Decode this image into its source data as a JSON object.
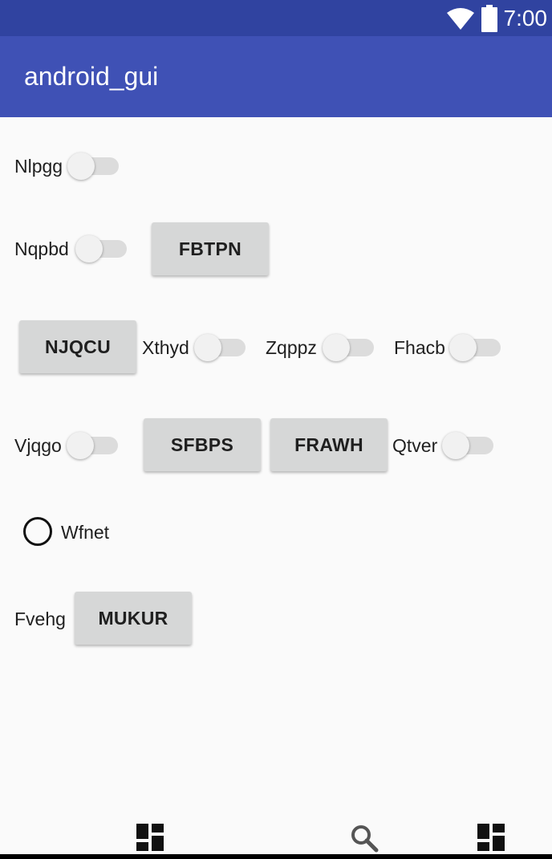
{
  "status_bar": {
    "time": "7:00",
    "wifi_icon": "wifi-icon",
    "battery_icon": "battery-icon"
  },
  "app_bar": {
    "title": "android_gui"
  },
  "rows": {
    "row1": {
      "label": "Nlpgg"
    },
    "row2": {
      "label": "Nqpbd",
      "button": "FBTPN"
    },
    "row3": {
      "button": "NJQCU",
      "label1": "Xthyd",
      "label2": "Zqppz",
      "label3": "Fhacb"
    },
    "row4": {
      "label1": "Vjqgo",
      "button1": "SFBPS",
      "button2": "FRAWH",
      "label2": "Qtver"
    },
    "row5": {
      "radio_label": "Wfnet"
    },
    "row6": {
      "label": "Fvehg",
      "button": "MUKUR"
    }
  },
  "switches": {
    "all_off": true
  },
  "nav_bar": {
    "left_icon": "dashboard-icon",
    "middle_icon": "search-icon",
    "right_icon": "dashboard-icon"
  },
  "colors": {
    "status_bar": "#3043a0",
    "app_bar": "#3f51b5",
    "background": "#fafafa",
    "button": "#d6d7d7"
  }
}
